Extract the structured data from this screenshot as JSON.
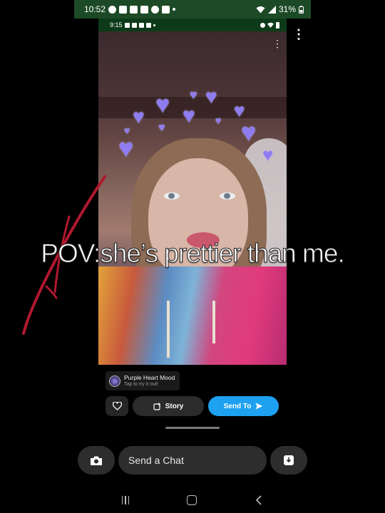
{
  "outer_status": {
    "time": "10:52",
    "battery": "31%",
    "icons": [
      "snapchat-icon",
      "c-app-icon",
      "youtube-icon",
      "youtube-icon",
      "tiktok-icon",
      "app-icon",
      "dot-icon",
      "wifi-icon",
      "signal-icon",
      "battery-icon"
    ]
  },
  "inner_status": {
    "time": "9:15",
    "icons": [
      "tiktok-icon",
      "youtube-icon",
      "clipboard-icon",
      "android-icon",
      "dot-icon",
      "eye-icon",
      "wifi-icon",
      "battery-icon"
    ]
  },
  "snap": {
    "caption": "POV:she’s prettier than me.",
    "lens_title": "Purple Heart Mood",
    "lens_subtitle": "Tap to try it out!",
    "story_label": "Story",
    "send_label": "Send To"
  },
  "chat": {
    "placeholder": "Send a Chat"
  },
  "colors": {
    "send_button": "#1ea1f1",
    "heart": "#8f7cf0",
    "scribble": "#b0182d",
    "status_bar": "#1d4a26"
  }
}
